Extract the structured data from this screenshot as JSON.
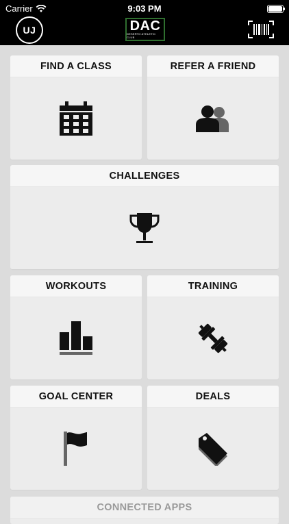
{
  "status": {
    "carrier": "Carrier",
    "time": "9:03 PM"
  },
  "header": {
    "avatar_initials": "UJ",
    "logo_text": "DAC",
    "logo_subtext": "DESERTO ATHLETIC CLUB",
    "barcode_icon": "barcode-scan-icon"
  },
  "tiles": {
    "find_class": {
      "label": "FIND A CLASS",
      "icon": "calendar-icon"
    },
    "refer_friend": {
      "label": "REFER A FRIEND",
      "icon": "users-icon"
    },
    "challenges": {
      "label": "CHALLENGES",
      "icon": "trophy-icon"
    },
    "workouts": {
      "label": "WORKOUTS",
      "icon": "bar-chart-icon"
    },
    "training": {
      "label": "TRAINING",
      "icon": "dumbbell-icon"
    },
    "goal_center": {
      "label": "GOAL CENTER",
      "icon": "flag-icon"
    },
    "deals": {
      "label": "DEALS",
      "icon": "tag-icon"
    },
    "connected_apps": {
      "label": "CONNECTED APPS"
    }
  },
  "colors": {
    "header_bg": "#000000",
    "page_bg": "#dcdcdc",
    "logo_border": "#2f6f2f",
    "tile_bg": "#ececec"
  }
}
